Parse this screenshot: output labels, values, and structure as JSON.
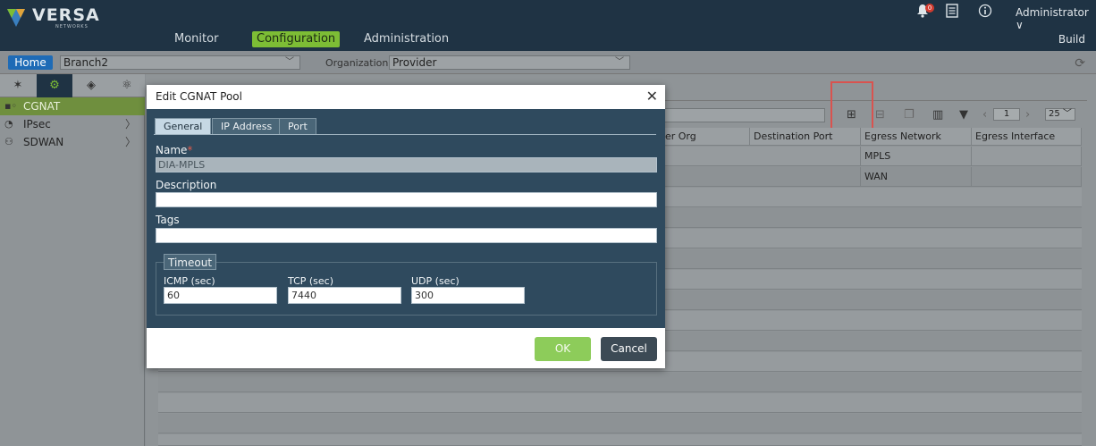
{
  "brand": {
    "name": "VERSA",
    "sub": "NETWORKS"
  },
  "nav": {
    "monitor": "Monitor",
    "configuration": "Configuration",
    "administration": "Administration",
    "build": "Build"
  },
  "topbar": {
    "notifications_count": "0",
    "user": "Administrator ∨"
  },
  "subbar": {
    "home": "Home",
    "appliance": "Branch2",
    "org_label": "Organization:",
    "org_value": "Provider"
  },
  "sidebar": {
    "tabs": [
      "network-tab",
      "configuration-tab",
      "objects-tab",
      "others-tab"
    ],
    "items": [
      {
        "label": "CGNAT",
        "icon": "cgnat-icon"
      },
      {
        "label": "IPsec",
        "icon": "ipsec-icon"
      },
      {
        "label": "SDWAN",
        "icon": "sdwan-icon"
      }
    ]
  },
  "toolbar": {
    "page": "1",
    "per_page": "25"
  },
  "table": {
    "columns": [
      "der Org",
      "Destination Port",
      "Egress Network",
      "Egress Interface"
    ],
    "rows": [
      [
        "",
        "",
        "MPLS",
        ""
      ],
      [
        "",
        "",
        "WAN",
        ""
      ]
    ]
  },
  "modal": {
    "title": "Edit CGNAT Pool",
    "tabs": [
      "General",
      "IP Address",
      "Port"
    ],
    "name_label": "Name",
    "name_value": "DIA-MPLS",
    "description_label": "Description",
    "description_value": "",
    "tags_label": "Tags",
    "tags_value": "",
    "timeout_label": "Timeout",
    "icmp_label": "ICMP (sec)",
    "icmp_value": "60",
    "tcp_label": "TCP (sec)",
    "tcp_value": "7440",
    "udp_label": "UDP (sec)",
    "udp_value": "300",
    "ok": "OK",
    "cancel": "Cancel"
  },
  "colors": {
    "nav_bg": "#1f3344",
    "accent_green": "#7dbd35",
    "modal_bg": "#2f4a5e",
    "highlight_red": "#d9534f"
  }
}
